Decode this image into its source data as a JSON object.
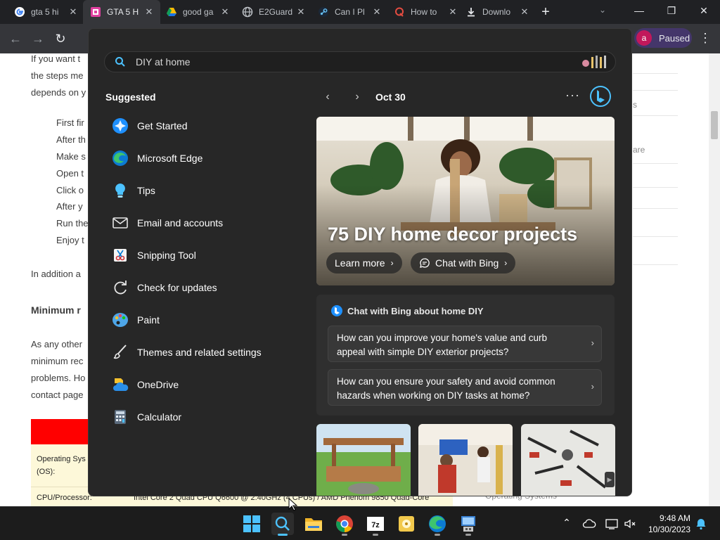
{
  "browser": {
    "tabs": [
      {
        "title": "gta 5 hi",
        "icon": "google-icon"
      },
      {
        "title": "GTA 5 H",
        "icon": "site-icon",
        "active": true
      },
      {
        "title": "good ga",
        "icon": "google-drive-icon"
      },
      {
        "title": "E2Guard",
        "icon": "globe-icon"
      },
      {
        "title": "Can I Pl",
        "icon": "steam-icon"
      },
      {
        "title": "How to",
        "icon": "quora-icon"
      },
      {
        "title": "Downlo",
        "icon": "download-icon"
      }
    ],
    "new_tab": "+",
    "profile": {
      "initial": "a",
      "label": "Paused"
    }
  },
  "page": {
    "intro_lines": [
      "If you want t",
      "the steps me",
      "depends on y"
    ],
    "bullets": [
      "First fir",
      "After th",
      "Make s",
      "Open t",
      "Click o",
      "After y",
      "Run the",
      "Enjoy t"
    ],
    "para2": "In addition a",
    "heading": "Minimum r",
    "para3_lines": [
      "As any other",
      "minimum rec",
      "problems. Ho",
      "contact page"
    ],
    "table": {
      "row1_label": "Operating Sys (OS):",
      "row2_label": "CPU/Processor:",
      "row2_value": "Intel Core 2 Quad CPU Q6600 @ 2.40GHz (4 CPUs) / AMD Phenom 9850 Quad-Core"
    },
    "sidebar_fragments": [
      "s",
      "are",
      "Operating Systems"
    ]
  },
  "flyout": {
    "search": {
      "value": "DIY at home"
    },
    "suggested_title": "Suggested",
    "suggested": [
      {
        "label": "Get Started",
        "icon": "get-started-icon"
      },
      {
        "label": "Microsoft Edge",
        "icon": "edge-icon"
      },
      {
        "label": "Tips",
        "icon": "tips-icon"
      },
      {
        "label": "Email and accounts",
        "icon": "email-icon"
      },
      {
        "label": "Snipping Tool",
        "icon": "snipping-tool-icon"
      },
      {
        "label": "Check for updates",
        "icon": "update-icon"
      },
      {
        "label": "Paint",
        "icon": "paint-icon"
      },
      {
        "label": "Themes and related settings",
        "icon": "brush-icon"
      },
      {
        "label": "OneDrive",
        "icon": "onedrive-icon"
      },
      {
        "label": "Calculator",
        "icon": "calculator-icon"
      }
    ],
    "date": "Oct 30",
    "hero": {
      "title": "75 DIY home decor projects",
      "learn_more": "Learn more",
      "chat_with_bing": "Chat with Bing"
    },
    "chat_card": {
      "title": "Chat with Bing about home DIY",
      "questions": [
        "How can you improve your home's value and curb appeal with simple DIY exterior projects?",
        "How can you ensure your safety and avoid common hazards when working on DIY tasks at home?"
      ]
    }
  },
  "taskbar": {
    "time": "9:48 AM",
    "date": "10/30/2023",
    "apps": [
      "windows-start-icon",
      "search-icon",
      "file-explorer-icon",
      "chrome-icon",
      "7zip-icon",
      "archive-icon",
      "edge-icon",
      "control-panel-icon"
    ]
  },
  "colors": {
    "accent": "#0f6cbd",
    "flyout_bg": "#272727",
    "taskbar_bg": "#1c1c1c",
    "red_bar": "#ff0000"
  }
}
